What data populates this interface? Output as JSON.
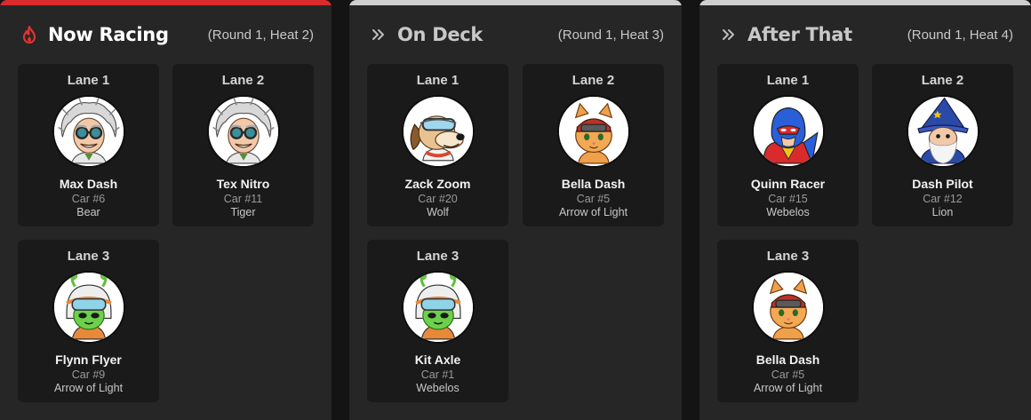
{
  "panels": [
    {
      "title": "Now Racing",
      "subtitle": "(Round 1, Heat 2)",
      "icon": "fire-icon",
      "accent": "#d92b2b",
      "title_color": "#ffffff",
      "cards": [
        {
          "lane": "Lane 1",
          "name": "Max Dash",
          "car": "Car #6",
          "rank": "Bear",
          "avatar": "scientist-avatar"
        },
        {
          "lane": "Lane 2",
          "name": "Tex Nitro",
          "car": "Car #11",
          "rank": "Tiger",
          "avatar": "scientist-avatar"
        },
        {
          "lane": "Lane 3",
          "name": "Flynn Flyer",
          "car": "Car #9",
          "rank": "Arrow of Light",
          "avatar": "alien-avatar"
        }
      ]
    },
    {
      "title": "On Deck",
      "subtitle": "(Round 1, Heat 3)",
      "icon": "double-chevron-right-icon",
      "accent": "#cfcfcf",
      "title_color": "#c8c8c8",
      "cards": [
        {
          "lane": "Lane 1",
          "name": "Zack Zoom",
          "car": "Car #20",
          "rank": "Wolf",
          "avatar": "dog-avatar"
        },
        {
          "lane": "Lane 2",
          "name": "Bella Dash",
          "car": "Car #5",
          "rank": "Arrow of Light",
          "avatar": "cat-avatar"
        },
        {
          "lane": "Lane 3",
          "name": "Kit Axle",
          "car": "Car #1",
          "rank": "Webelos",
          "avatar": "alien-avatar"
        }
      ]
    },
    {
      "title": "After That",
      "subtitle": "(Round 1, Heat 4)",
      "icon": "double-chevron-right-icon",
      "accent": "#cfcfcf",
      "title_color": "#c8c8c8",
      "cards": [
        {
          "lane": "Lane 1",
          "name": "Quinn Racer",
          "car": "Car #15",
          "rank": "Webelos",
          "avatar": "superhero-avatar"
        },
        {
          "lane": "Lane 2",
          "name": "Dash Pilot",
          "car": "Car #12",
          "rank": "Lion",
          "avatar": "wizard-avatar"
        },
        {
          "lane": "Lane 3",
          "name": "Bella Dash",
          "car": "Car #5",
          "rank": "Arrow of Light",
          "avatar": "cat-avatar"
        }
      ]
    }
  ]
}
